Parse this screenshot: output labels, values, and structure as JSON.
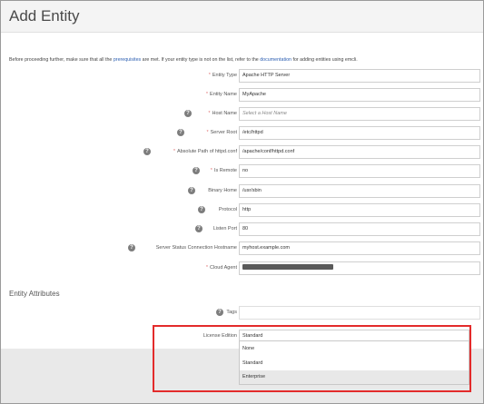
{
  "page": {
    "title": "Add Entity"
  },
  "intro": {
    "before": "Before proceeding further, make sure that all the",
    "link1": "prerequisites",
    "middle": "are met. If your entity type is not on the list, refer to the",
    "link2": "documentation",
    "after": "for adding entities using emcli."
  },
  "fields": [
    {
      "label": "Entity Type",
      "required": true,
      "info": false,
      "value": "Apache HTTP Server"
    },
    {
      "label": "Entity Name",
      "required": true,
      "info": false,
      "value": "MyApache"
    },
    {
      "label": "Host Name",
      "required": true,
      "info": true,
      "placeholder": "Select a Host Name"
    },
    {
      "label": "Server Root",
      "required": true,
      "info": true,
      "value": "/etc/httpd"
    },
    {
      "label": "Absolute Path of httpd.conf",
      "required": true,
      "info": true,
      "value": "/apache/conf/httpd.conf"
    },
    {
      "label": "Is Remote",
      "required": true,
      "info": true,
      "value": "no"
    },
    {
      "label": "Binary Home",
      "required": false,
      "info": true,
      "value": "/usr/sbin"
    },
    {
      "label": "Protocol",
      "required": false,
      "info": true,
      "value": "http"
    },
    {
      "label": "Listen Port",
      "required": false,
      "info": true,
      "value": "80"
    },
    {
      "label": "Server Status Connection Hostname",
      "required": false,
      "info": true,
      "value": "myhost.example.com"
    },
    {
      "label": "Cloud Agent",
      "required": true,
      "info": false,
      "value": ""
    }
  ],
  "attributes": {
    "section_title": "Entity Attributes",
    "tags_label": "Tags",
    "license_label": "License Edition",
    "license_value": "Standard",
    "license_options": [
      "None",
      "Standard",
      "Enterprise"
    ],
    "highlighted_option": "Enterprise"
  },
  "colors": {
    "highlight_border": "#e32b2b",
    "link": "#2a5db0"
  }
}
